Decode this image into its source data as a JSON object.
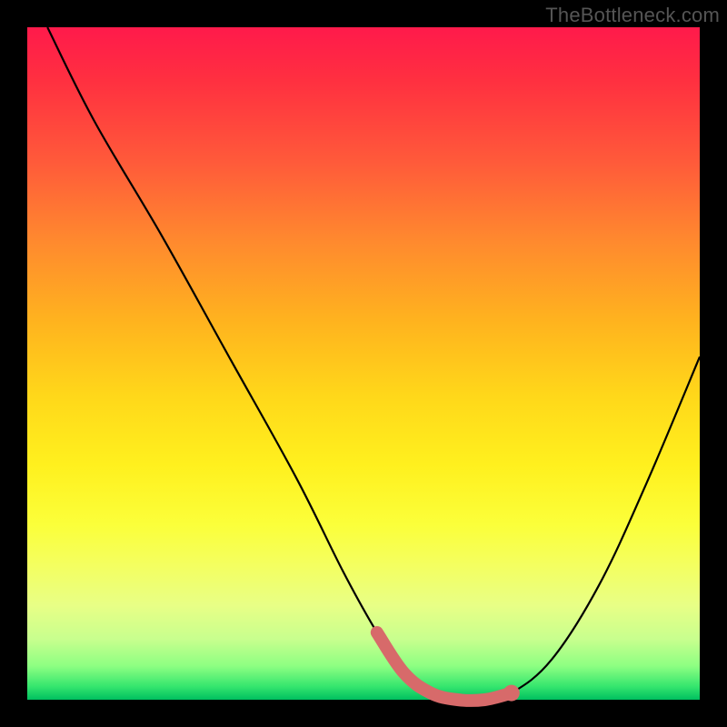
{
  "watermark": "TheBottleneck.com",
  "colors": {
    "frame": "#000000",
    "curve": "#000000",
    "highlight": "#d76a6a"
  },
  "chart_data": {
    "type": "line",
    "title": "",
    "xlabel": "",
    "ylabel": "",
    "xlim": [
      0,
      100
    ],
    "ylim": [
      0,
      100
    ],
    "series": [
      {
        "name": "bottleneck-curve",
        "x": [
          3,
          10,
          20,
          30,
          40,
          47,
          52,
          56,
          60,
          64,
          68,
          72,
          78,
          85,
          92,
          100
        ],
        "y": [
          100,
          86,
          69,
          51,
          33,
          19,
          10,
          4,
          1,
          0,
          0,
          1,
          6,
          17,
          32,
          51
        ]
      }
    ],
    "highlight_region": {
      "x": [
        52,
        56,
        60,
        64,
        68,
        72
      ],
      "y": [
        10,
        4,
        1,
        0,
        0,
        1
      ]
    }
  }
}
